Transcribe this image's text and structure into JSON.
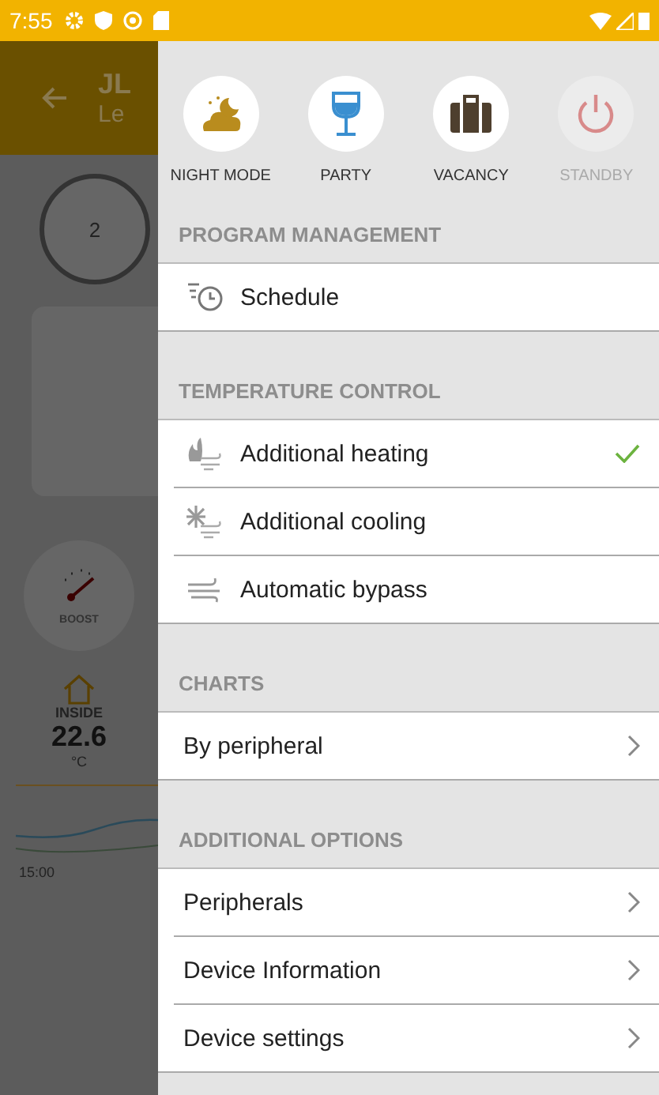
{
  "status_bar": {
    "time": "7:55"
  },
  "background_app": {
    "title": "JL",
    "subtitle": "Le",
    "fan_speed": "2",
    "boost_label": "BOOST",
    "inside_label": "INSIDE",
    "inside_temp": "22.6",
    "unit": "°C",
    "chart_time": "15:00"
  },
  "drawer": {
    "modes": [
      {
        "label": "NIGHT MODE",
        "kind": "night",
        "disabled": false
      },
      {
        "label": "PARTY",
        "kind": "party",
        "disabled": false
      },
      {
        "label": "VACANCY",
        "kind": "vacancy",
        "disabled": false
      },
      {
        "label": "STANDBY",
        "kind": "standby",
        "disabled": true
      }
    ],
    "sections": [
      {
        "title": "PROGRAM MANAGEMENT",
        "items": [
          {
            "label": "Schedule",
            "kind": "schedule"
          }
        ]
      },
      {
        "title": "TEMPERATURE CONTROL",
        "items": [
          {
            "label": "Additional heating",
            "kind": "heating",
            "checked": true
          },
          {
            "label": "Additional cooling",
            "kind": "cooling",
            "checked": false
          },
          {
            "label": "Automatic bypass",
            "kind": "bypass",
            "checked": false
          }
        ]
      },
      {
        "title": "CHARTS",
        "items": [
          {
            "label": "By peripheral",
            "kind": "link"
          }
        ]
      },
      {
        "title": "ADDITIONAL OPTIONS",
        "items": [
          {
            "label": "Peripherals",
            "kind": "link"
          },
          {
            "label": "Device Information",
            "kind": "link"
          },
          {
            "label": "Device settings",
            "kind": "link"
          }
        ]
      }
    ]
  }
}
